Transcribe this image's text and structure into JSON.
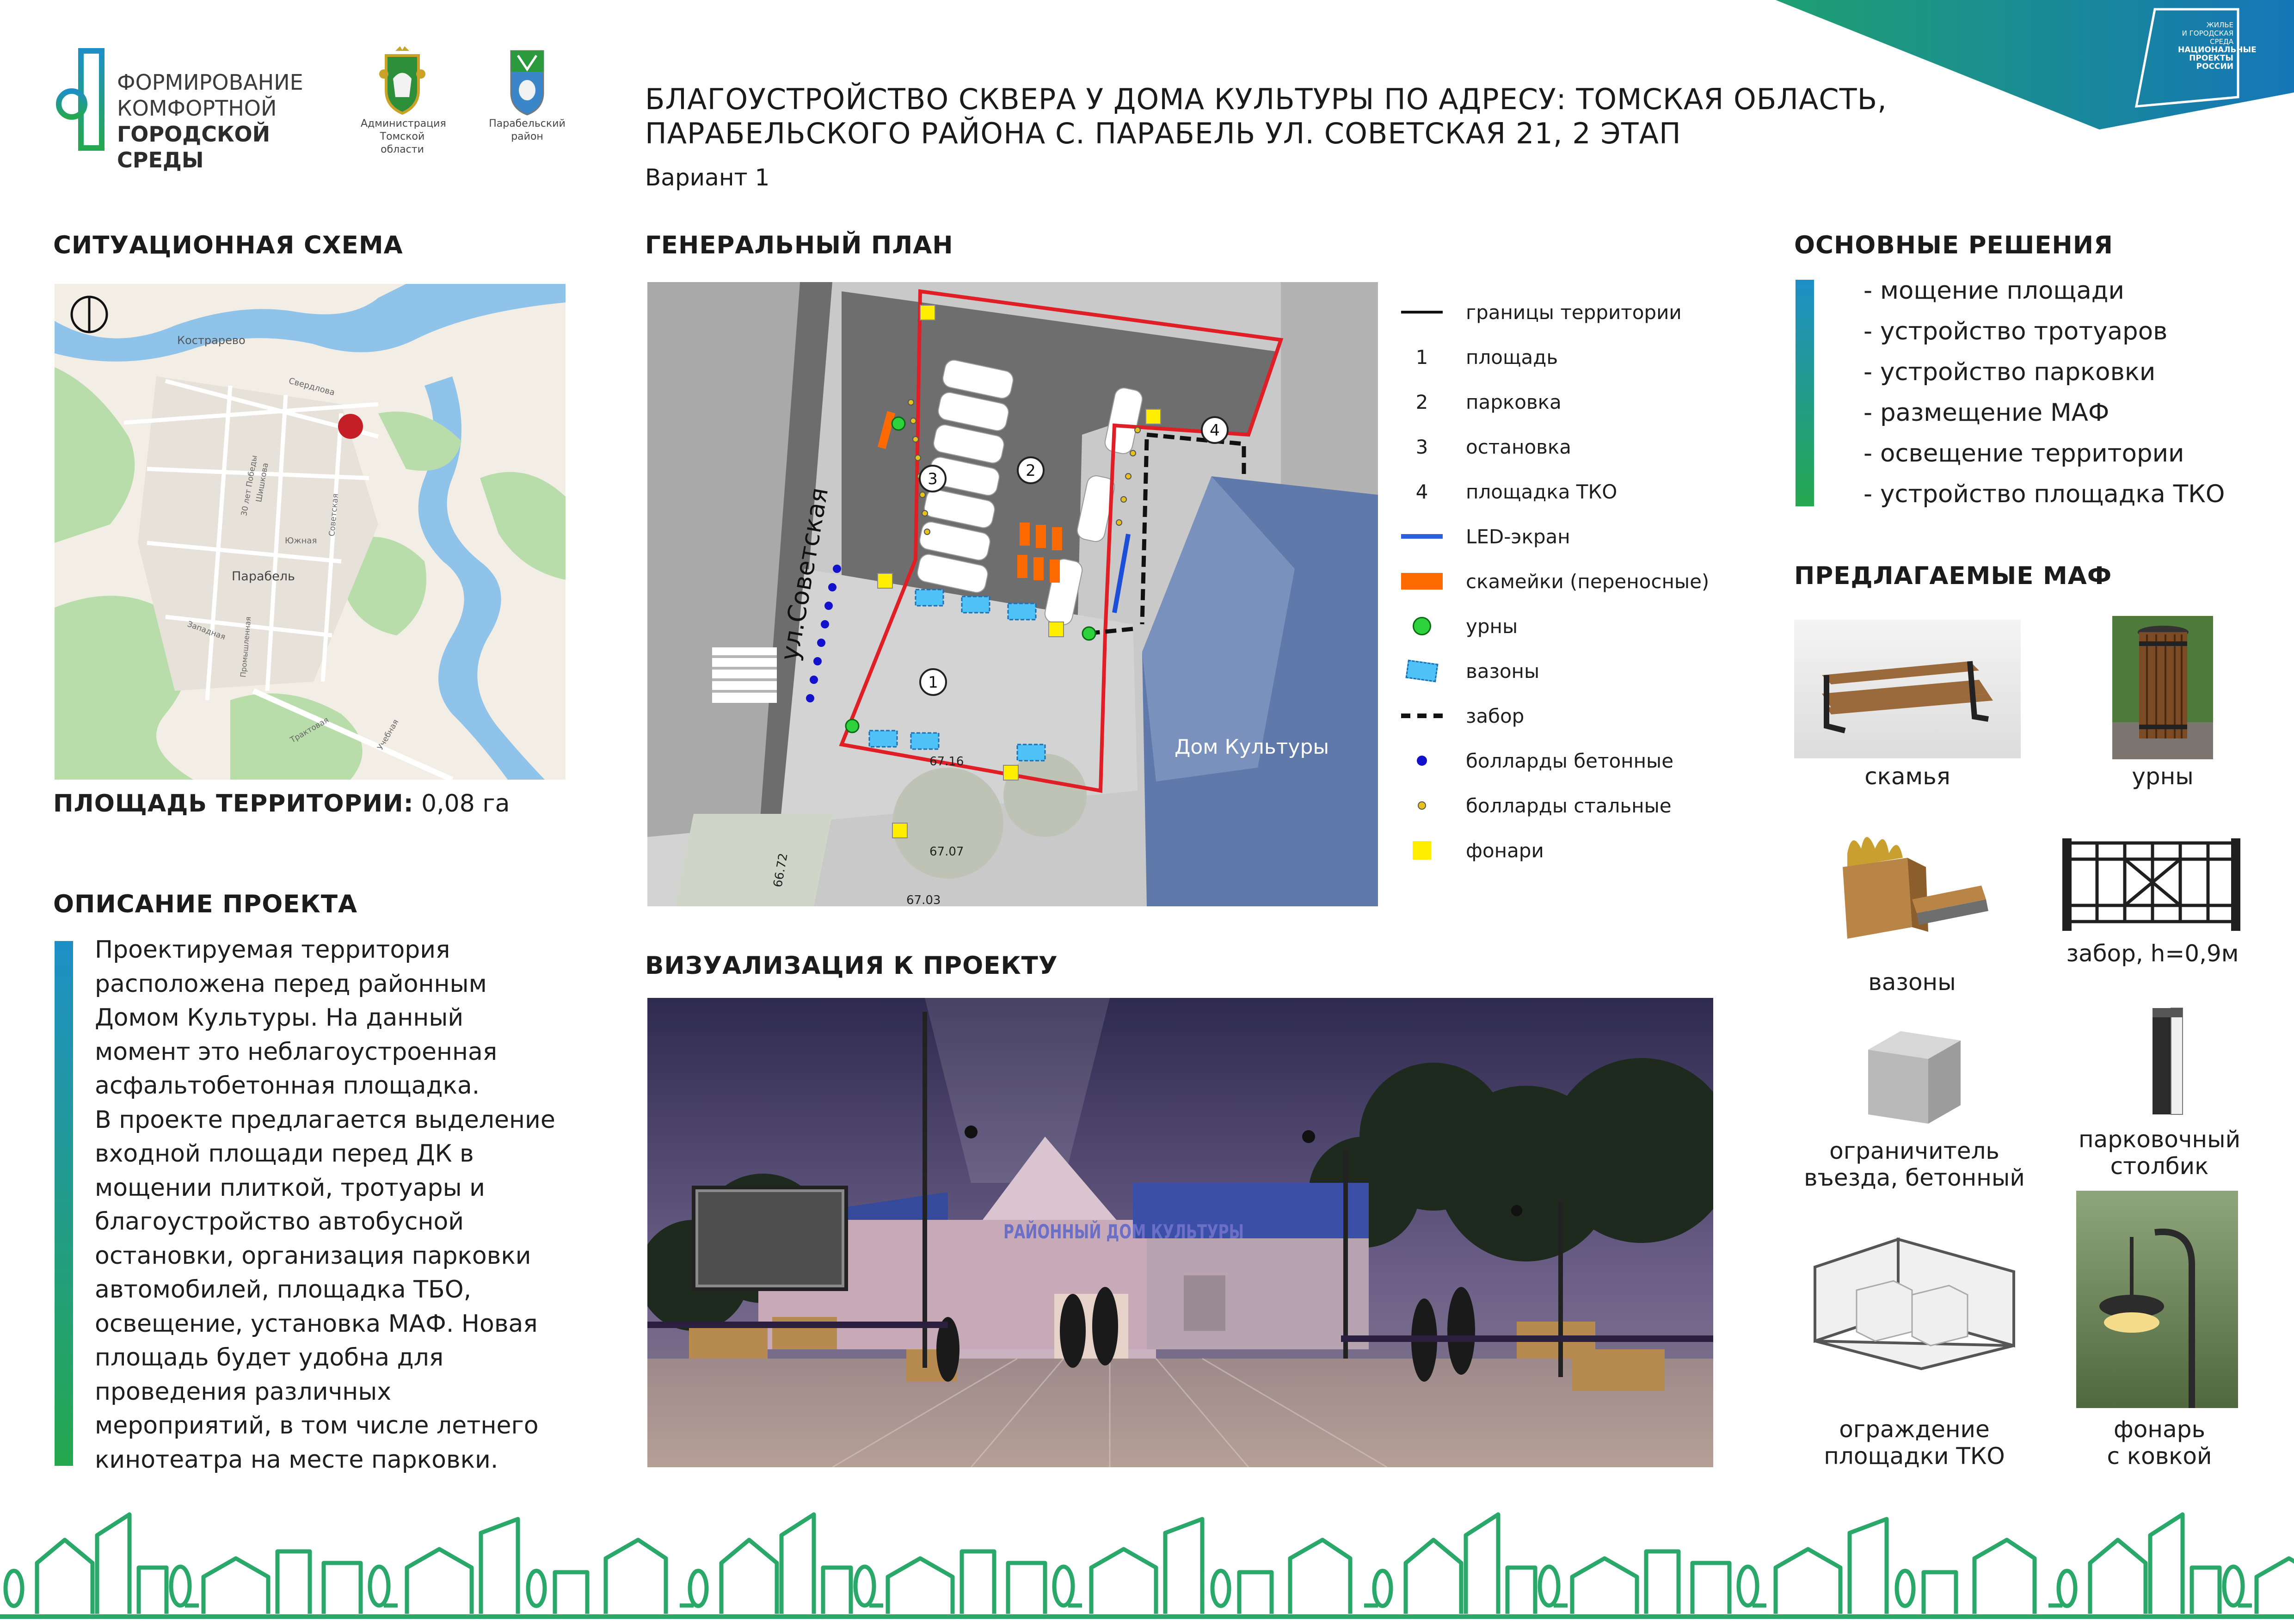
{
  "header": {
    "logo_line1": "ФОРМИРОВАНИЕ",
    "logo_line2": "КОМФОРТНОЙ",
    "logo_line3": "ГОРОДСКОЙ СРЕДЫ",
    "admin_line1": "Администрация",
    "admin_line2": "Томской области",
    "district_line1": "Парабельский",
    "district_line2": "район",
    "title_line1": "БЛАГОУСТРОЙСТВО СКВЕРА У ДОМА КУЛЬТУРЫ ПО АДРЕСУ: ТОМСКАЯ ОБЛАСТЬ,",
    "title_line2": "ПАРАБЕЛЬСКОГО РАЙОНА С. ПАРАБЕЛЬ УЛ. СОВЕТСКАЯ 21, 2 ЭТАП",
    "variant": "Вариант 1",
    "national_line1": "ЖИЛЬЕ",
    "national_line2": "И ГОРОДСКАЯ СРЕДА",
    "national_line3": "НАЦИОНАЛЬНЫЕ",
    "national_line4": "ПРОЕКТЫ",
    "national_line5": "РОССИИ"
  },
  "situation": {
    "heading": "СИТУАЦИОННАЯ СХЕМА",
    "map_labels": [
      "Кострарево",
      "Свердлова",
      "30 лет Победы",
      "Шишкова",
      "Южная",
      "Советская",
      "Парабель",
      "Западная",
      "Промышленная",
      "Трактовая",
      "Учебная"
    ],
    "area_label": "ПЛОЩАДЬ ТЕРРИТОРИИ:",
    "area_value": "0,08 га"
  },
  "description": {
    "heading": "ОПИСАНИЕ ПРОЕКТА",
    "lines": [
      "Проектируемая территория",
      "расположена перед районным",
      "Домом Культуры. На данный",
      "момент это неблагоустроенная",
      "асфальтобетонная площадка.",
      "В проекте предлагается выделение",
      "входной площади перед ДК в",
      "мощении плиткой, тротуары и",
      "благоустройство автобусной",
      "остановки, организация парковки",
      "автомобилей, площадка ТБО,",
      "освещение, установка МАФ. Новая",
      "площадь будет удобна для",
      "проведения различных",
      "мероприятий, в том числе летнего",
      "кинотеатра на месте парковки."
    ]
  },
  "general_plan": {
    "heading": "ГЕНЕРАЛЬНЫЙ ПЛАН",
    "street_label": "ул.Советская",
    "building_label": "Дом Культуры",
    "zone_numbers": [
      "1",
      "2",
      "3",
      "4"
    ],
    "elevations": [
      "67.16",
      "67.07",
      "66.72",
      "67.03"
    ],
    "legend": [
      {
        "symbol": "line-black",
        "label": "границы территории"
      },
      {
        "symbol": "number",
        "number": "1",
        "label": "площадь"
      },
      {
        "symbol": "number",
        "number": "2",
        "label": "парковка"
      },
      {
        "symbol": "number",
        "number": "3",
        "label": "остановка"
      },
      {
        "symbol": "number",
        "number": "4",
        "label": "площадка ТКО"
      },
      {
        "symbol": "line-blue",
        "label": "LED-экран"
      },
      {
        "symbol": "rect-orange",
        "label": "скамейки (переносные)"
      },
      {
        "symbol": "circle-green",
        "label": "урны"
      },
      {
        "symbol": "rect-cyan",
        "label": "вазоны"
      },
      {
        "symbol": "dashed",
        "label": "забор"
      },
      {
        "symbol": "dot-blue",
        "label": "болларды бетонные"
      },
      {
        "symbol": "dot-yellow",
        "label": "болларды стальные"
      },
      {
        "symbol": "square-yellow",
        "label": "фонари"
      }
    ]
  },
  "visualization": {
    "heading": "ВИЗУАЛИЗАЦИЯ К ПРОЕКТУ",
    "sign_text": "РАЙОННЫЙ ДОМ КУЛЬТУРЫ"
  },
  "solutions": {
    "heading": "ОСНОВНЫЕ РЕШЕНИЯ",
    "items": [
      "- мощение площади",
      "- устройство тротуаров",
      "- устройство парковки",
      "- размещение МАФ",
      "- освещение территории",
      "- устройство площадка ТКО"
    ]
  },
  "maf": {
    "heading": "ПРЕДЛАГАЕМЫЕ МАФ",
    "bench": "скамья",
    "bins": "урны",
    "planters": "вазоны",
    "fence": "забор, h=0,9м",
    "limiter_line1": "ограничитель",
    "limiter_line2": "въезда, бетонный",
    "post_line1": "парковочный",
    "post_line2": "столбик",
    "tko_line1": "ограждение",
    "tko_line2": "площадки ТКО",
    "lamp_line1": "фонарь",
    "lamp_line2": "с ковкой"
  },
  "colors": {
    "accent_green": "#25a84f",
    "accent_blue": "#1e8fc6",
    "boundary_red": "#e01e25",
    "footer_green": "#2aa86a"
  }
}
